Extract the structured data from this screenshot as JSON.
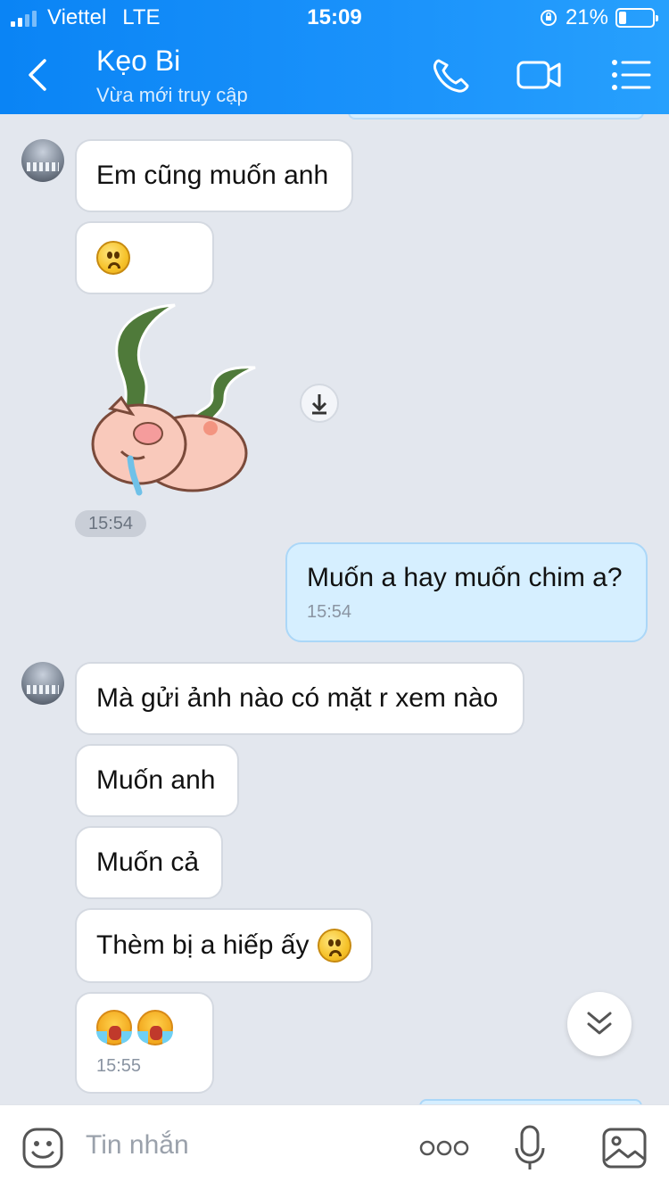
{
  "status_bar": {
    "carrier": "Viettel",
    "network": "LTE",
    "time": "15:09",
    "battery": "21%",
    "battery_level": 0.21
  },
  "header": {
    "title": "Kẹo Bi",
    "subtitle": "Vừa mới truy cập",
    "icons": [
      "back-icon",
      "phone-icon",
      "video-camera-icon",
      "menu-icon"
    ]
  },
  "messages": [
    {
      "from": "them",
      "text": "Em cũng muốn anh"
    },
    {
      "from": "them",
      "emoji": "sad-face"
    },
    {
      "from": "them",
      "sticker": "crying-pig"
    },
    {
      "time_label": "15:54"
    },
    {
      "from": "me",
      "text": "Muốn a hay muốn chim a?",
      "time": "15:54"
    },
    {
      "from": "them",
      "text": "Mà gửi ảnh nào có mặt r xem nào"
    },
    {
      "from": "them",
      "text": "Muốn anh"
    },
    {
      "from": "them",
      "text": "Muốn cả"
    },
    {
      "from": "them",
      "text": "Thèm bị a hiếp ấy",
      "emoji": "sad-face"
    },
    {
      "from": "them",
      "emoji": "crying x2",
      "time": "15:55"
    }
  ],
  "input": {
    "placeholder": "Tin nhắn",
    "icons": [
      "sticker-icon",
      "more-icon",
      "microphone-icon",
      "image-icon"
    ]
  },
  "colors": {
    "header": "#0a84f5",
    "background": "#e3e7ee",
    "my_bubble": "#d6efff",
    "their_bubble": "#ffffff"
  }
}
